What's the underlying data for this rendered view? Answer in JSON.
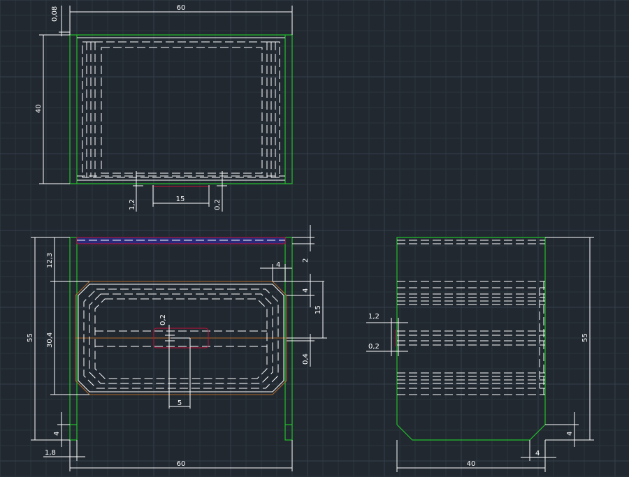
{
  "drawing": {
    "top_view": {
      "width_dim": "60",
      "height_dim": "40",
      "offset_dim": "0,08",
      "slot_left_dim": "1,2",
      "slot_length_dim": "15",
      "slot_right_dim": "0,2"
    },
    "front_view": {
      "height_dim": "55",
      "top_dim": "12,3",
      "mid_dim": "30,4",
      "bottom_dim": "4",
      "leg_dim": "1,8",
      "width_dim": "60",
      "chamfer_dim": "4",
      "top_right_dim": "2",
      "right_upper_dim": "4",
      "right_span_dim": "15",
      "right_lower_dim": "0,4",
      "center_gap_dim": "0,2",
      "center_width_dim": "5"
    },
    "side_view": {
      "upper_dim": "1,2",
      "lower_dim": "0,2",
      "height_dim": "55",
      "bottom_dim": "4",
      "width_dim": "40",
      "chamfer_dim": "4"
    }
  },
  "colors": {
    "background": "#212830",
    "outline": "#22c02a",
    "dimension": "#ffffff",
    "construction": "#b06a2a",
    "highlight": "#c0103a"
  }
}
